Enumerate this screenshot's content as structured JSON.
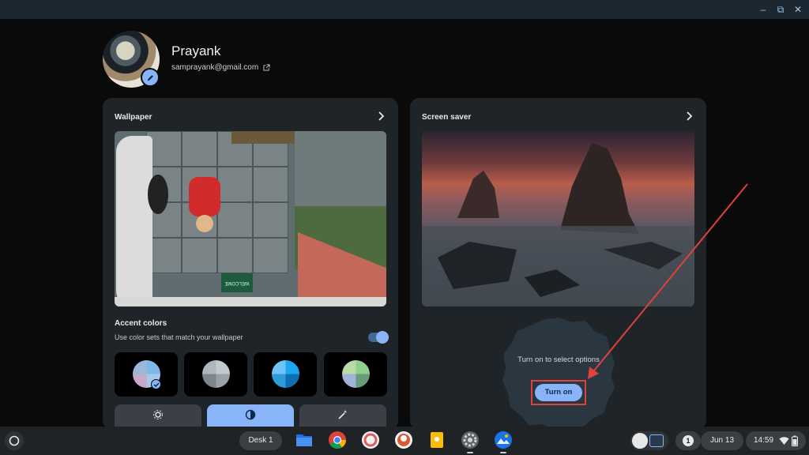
{
  "profile": {
    "name": "Prayank",
    "email": "samprayank@gmail.com"
  },
  "wallpaper_card": {
    "title": "Wallpaper",
    "accent_title": "Accent colors",
    "accent_subtitle": "Use color sets that match your wallpaper",
    "accent_toggle_on": true,
    "mat_text": "WELCOME",
    "swatches": [
      {
        "colors": [
          "#7db8e8",
          "#a8c8e8",
          "#c9a9c9",
          "#9bb8d8"
        ],
        "selected": true
      },
      {
        "colors": [
          "#c2c8cc",
          "#9aa2a8",
          "#7d868c",
          "#b0b7bc"
        ],
        "selected": false
      },
      {
        "colors": [
          "#1ea7f0",
          "#0d6fb0",
          "#2f9ad8",
          "#6cc4f7"
        ],
        "selected": false
      },
      {
        "colors": [
          "#8fd08a",
          "#6a9b78",
          "#9fb4d6",
          "#b9dba6"
        ],
        "selected": false
      }
    ],
    "mode_icons": [
      "brightness-icon",
      "contrast-icon",
      "magic-wand-icon"
    ]
  },
  "screensaver_card": {
    "title": "Screen saver",
    "hint": "Turn on to select options",
    "button_label": "Turn on"
  },
  "shelf": {
    "desk_label": "Desk 1",
    "apps": [
      "files",
      "chrome",
      "photos-app",
      "duckduckgo",
      "keep",
      "settings",
      "wallpaper-app"
    ],
    "notification_count": "1",
    "date": "Jun 13",
    "time": "14:59"
  },
  "colors": {
    "accent": "#8ab4f8",
    "annotation_red": "#e0413a",
    "card_bg": "#1f2429"
  }
}
